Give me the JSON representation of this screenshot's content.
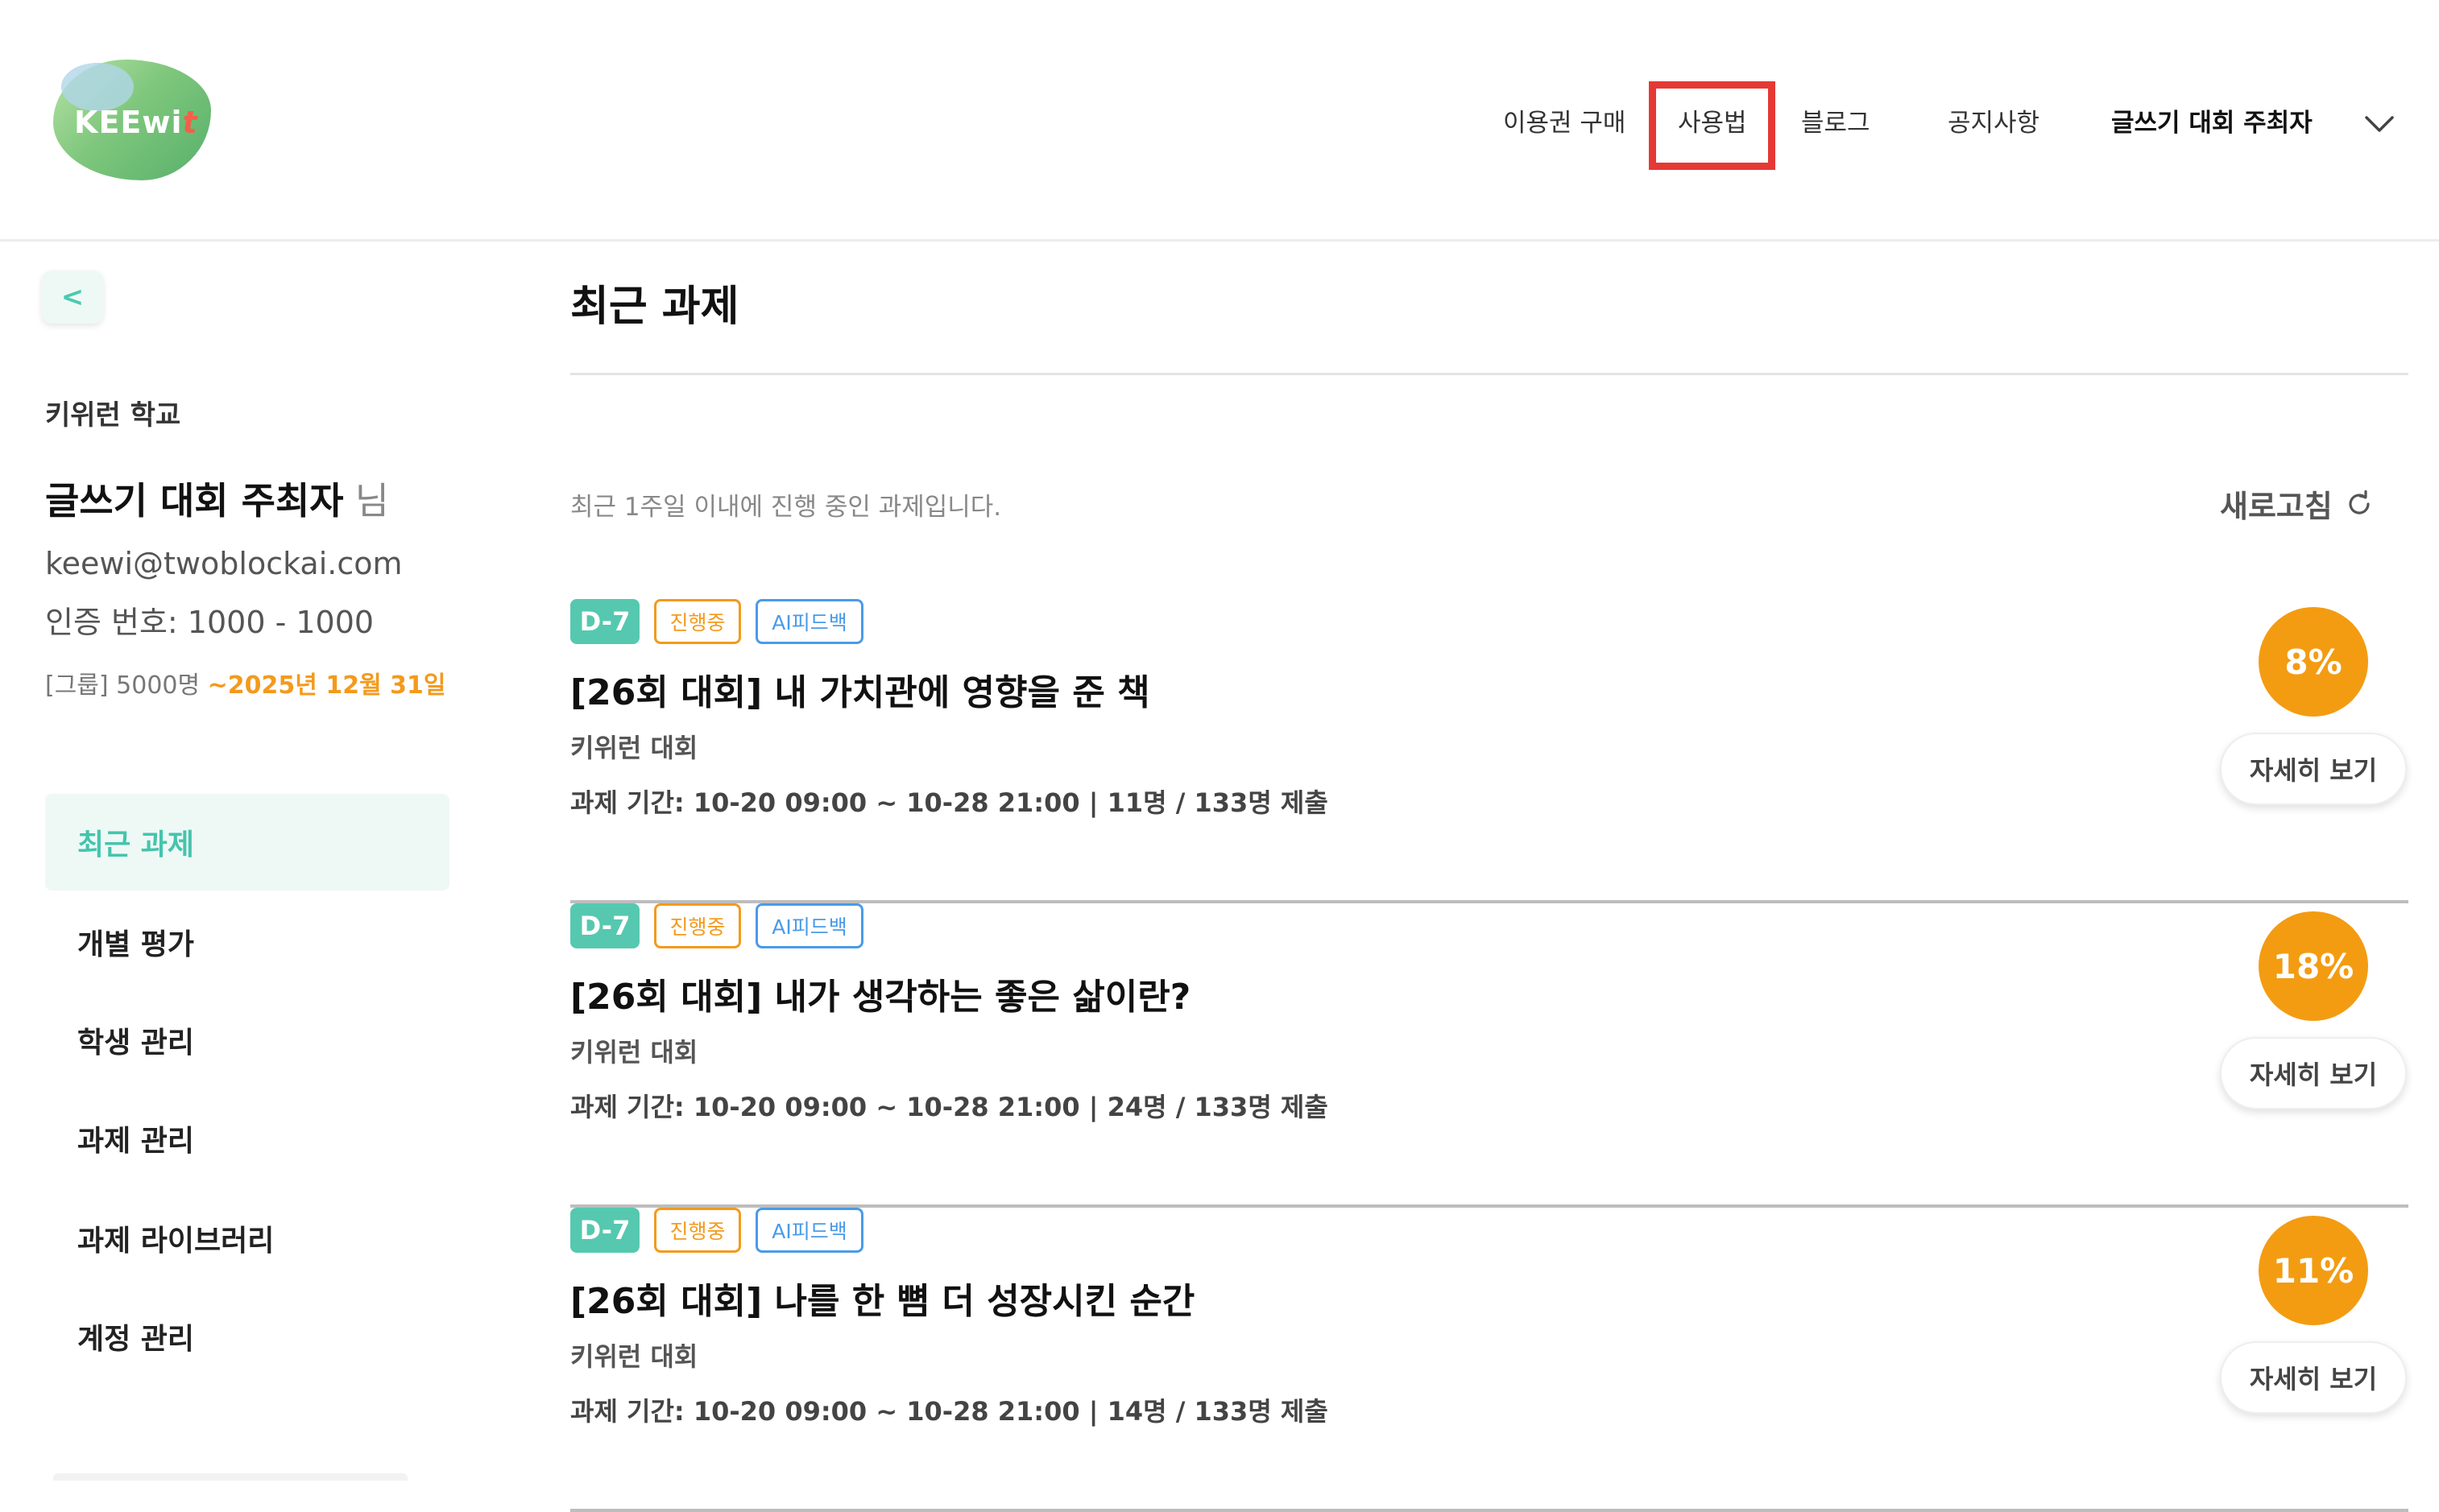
{
  "header": {
    "logo_text": "KEEwit",
    "nav": {
      "buy": "이용권 구매",
      "howto": "사용법",
      "blog": "블로그",
      "notice": "공지사항",
      "user": "글쓰기 대회 주최자"
    }
  },
  "sidebar": {
    "collapse_glyph": "<",
    "school": "키위런 학교",
    "user_name": "글쓰기 대회 주최자",
    "user_suffix": "님",
    "email": "keewi@twoblockai.com",
    "auth": "인증 번호: 1000 - 1000",
    "group_label": "[그룹] 5000명 ",
    "group_expiry": "~2025년 12월 31일",
    "menu": [
      {
        "label": "최근 과제",
        "active": true
      },
      {
        "label": "개별 평가",
        "active": false
      },
      {
        "label": "학생 관리",
        "active": false
      },
      {
        "label": "과제 관리",
        "active": false
      },
      {
        "label": "과제 라이브러리",
        "active": false
      },
      {
        "label": "계정 관리",
        "active": false
      }
    ]
  },
  "main": {
    "title": "최근 과제",
    "subtitle": "최근 1주일 이내에 진행 중인 과제입니다.",
    "refresh_label": "새로고침",
    "detail_label": "자세히 보기",
    "tasks": [
      {
        "dday": "D-7",
        "status": "진행중",
        "ai": "AI피드백",
        "title": "[26회 대회] 내 가치관에 영향을 준 책",
        "org": "키위런 대회",
        "period": "과제 기간: 10-20 09:00 ~ 10-28 21:00 | 11명 / 133명 제출",
        "progress": "8%"
      },
      {
        "dday": "D-7",
        "status": "진행중",
        "ai": "AI피드백",
        "title": "[26회 대회] 내가 생각하는 좋은 삶이란?",
        "org": "키위런 대회",
        "period": "과제 기간: 10-20 09:00 ~ 10-28 21:00 | 24명 / 133명 제출",
        "progress": "18%"
      },
      {
        "dday": "D-7",
        "status": "진행중",
        "ai": "AI피드백",
        "title": "[26회 대회] 나를 한 뼘 더 성장시킨 순간",
        "org": "키위런 대회",
        "period": "과제 기간: 10-20 09:00 ~ 10-28 21:00 | 14명 / 133명 제출",
        "progress": "11%"
      }
    ]
  },
  "colors": {
    "accent_mint": "#56c8b0",
    "status_orange": "#f39a1d",
    "ai_blue": "#4a9be8",
    "highlight_red": "#e53935"
  },
  "icons": {
    "logo": "keewit-logo",
    "nav_dropdown": "chevron-down-icon",
    "refresh": "refresh-icon"
  }
}
